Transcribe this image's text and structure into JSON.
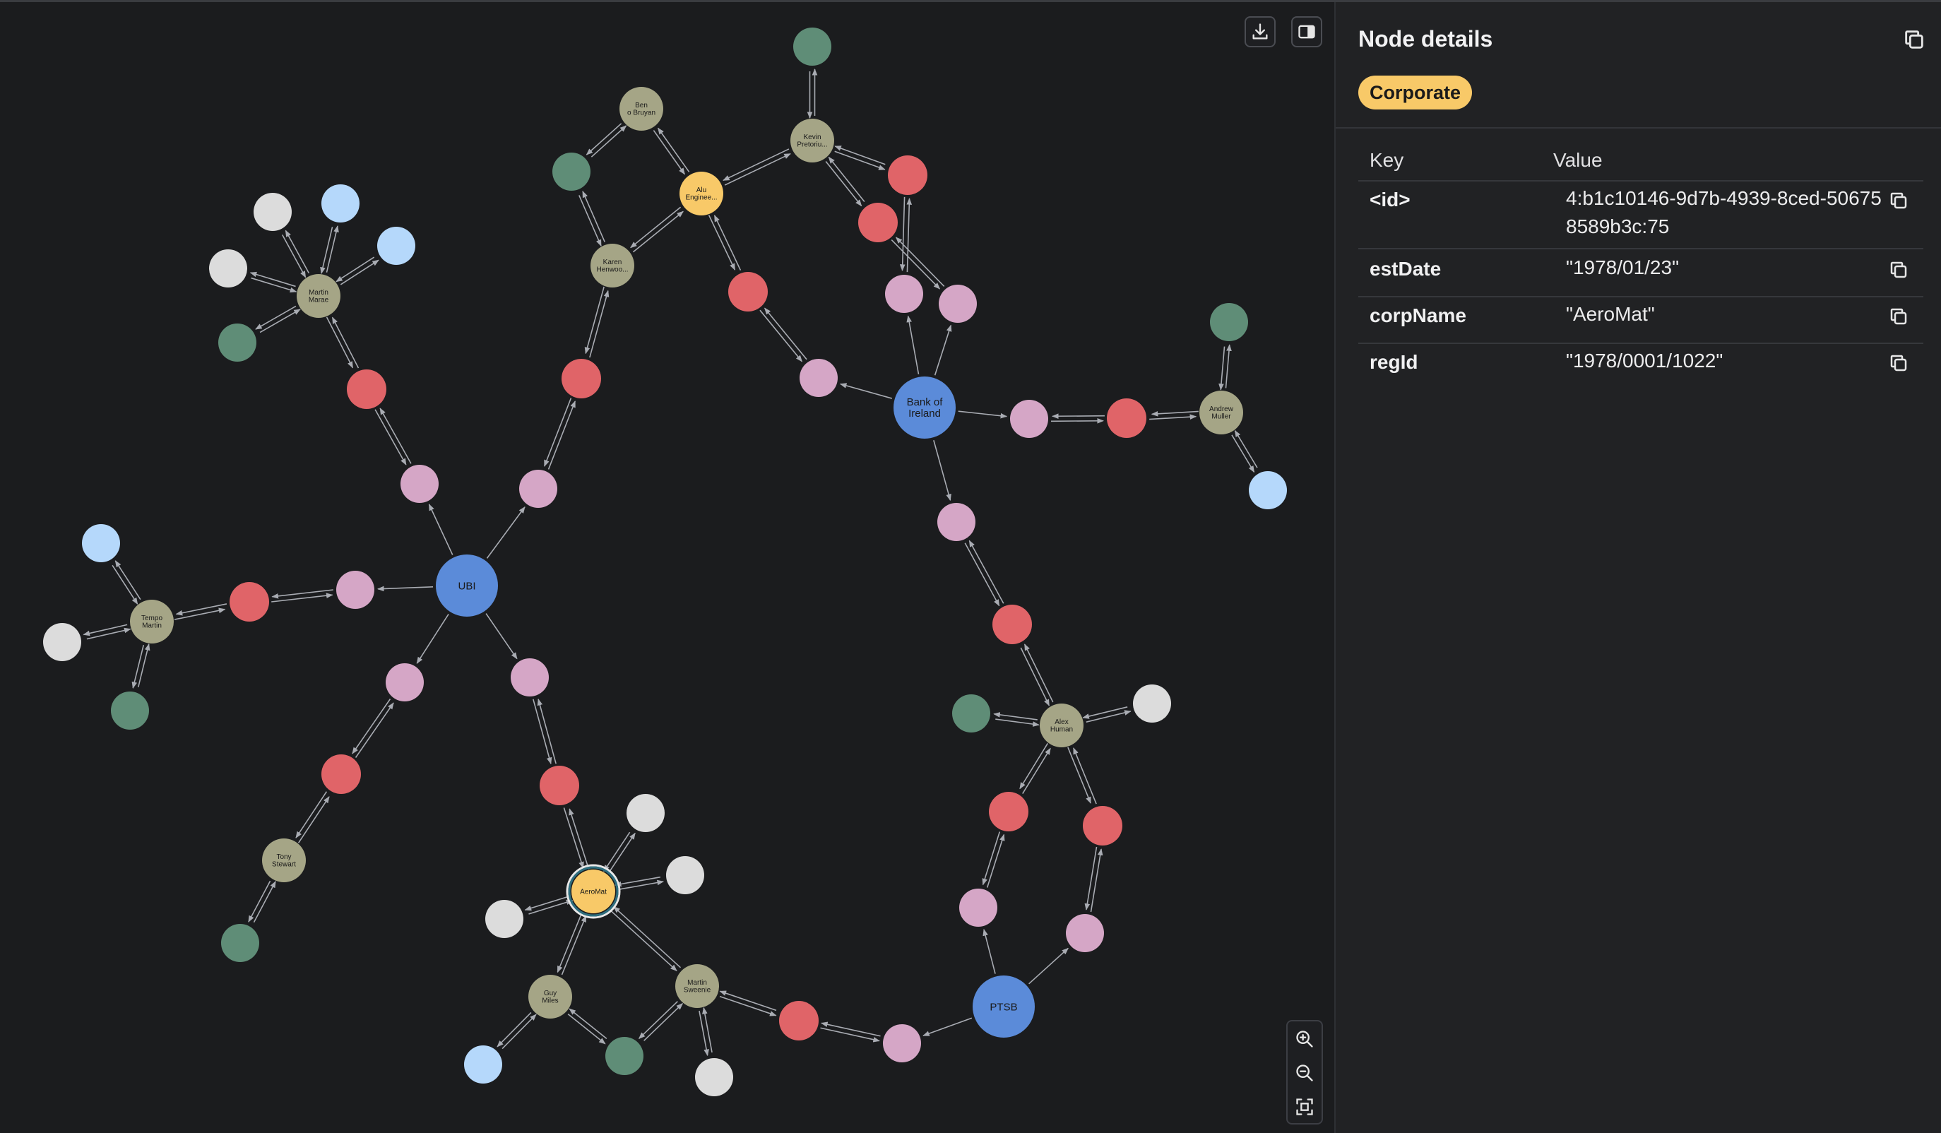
{
  "panel": {
    "title": "Node details",
    "label_badge": "Corporate",
    "columns": {
      "key": "Key",
      "value": "Value"
    },
    "properties": [
      {
        "key": "<id>",
        "value": "4:b1c10146-9d7b-4939-8ced-506758589b3c:75"
      },
      {
        "key": "estDate",
        "value": "\"1978/01/23\""
      },
      {
        "key": "corpName",
        "value": "\"AeroMat\""
      },
      {
        "key": "regId",
        "value": "\"1978/0001/1022\""
      }
    ]
  },
  "colors": {
    "background": "#1b1c1e",
    "panel": "#212224",
    "bank": "#5b8bd9",
    "person": "#a5a586",
    "corporate": "#f8c968",
    "account": "#e06468",
    "transaction": "#d5a6c6",
    "green_node": "#5f8d77",
    "blue_node": "#b5d8fb",
    "white_node": "#dcdcdc",
    "edge": "#a9acb3"
  },
  "graph": {
    "node_labels": {
      "UBI": "UBI",
      "BOI": "Bank of Ireland",
      "PTSB": "PTSB",
      "AeroMat": "AeroMat",
      "Alu": "Alu Enginee...",
      "MartinM": "Martin Marae",
      "BenO": "Ben o Bruyan",
      "Kevin": "Kevin Pretoriu...",
      "Karen": "Karen Henwoo...",
      "Andrew": "Andrew Muller",
      "Tempo": "Tempo Martin",
      "Tony": "Tony Stewart",
      "Alex": "Alex Human",
      "Guy": "Guy Miles",
      "MartinS": "Martin Sweenie"
    },
    "selected_node": "AeroMat",
    "icons": {
      "download": "download-icon",
      "layout": "sidebar-toggle-icon",
      "zoom_in": "zoom-in-icon",
      "zoom_out": "zoom-out-icon",
      "fit": "fit-to-screen-icon",
      "copy": "copy-icon"
    }
  }
}
